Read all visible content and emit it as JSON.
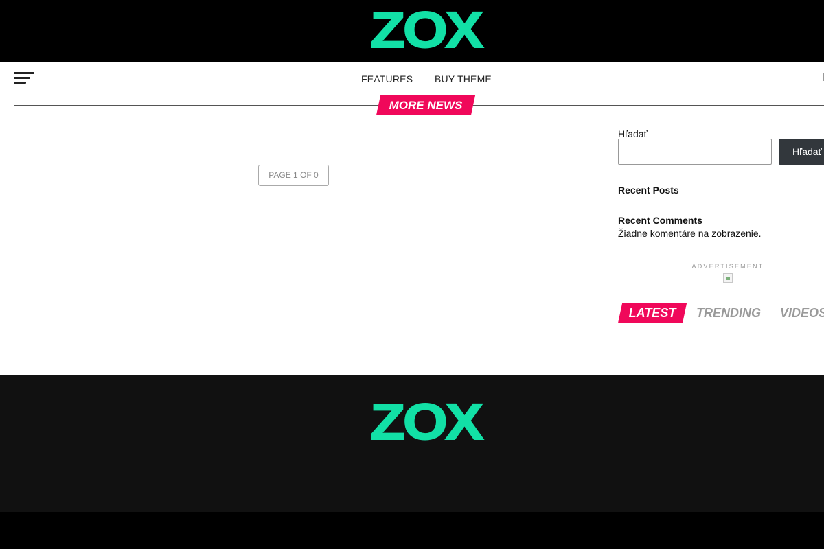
{
  "header": {
    "logo_text": "ZOX"
  },
  "nav": {
    "links": [
      {
        "label": "FEATURES"
      },
      {
        "label": "BUY THEME"
      }
    ]
  },
  "section": {
    "title": "MORE NEWS"
  },
  "pagination": {
    "label": "PAGE 1 OF 0"
  },
  "sidebar": {
    "search": {
      "label": "Hľadať",
      "value": "",
      "button_label": "Hľadať"
    },
    "recent_posts_title": "Recent Posts",
    "recent_comments_title": "Recent Comments",
    "no_comments_text": "Žiadne komentáre na zobrazenie.",
    "advertisement_label": "ADVERTISEMENT",
    "tabs": [
      {
        "label": "LATEST",
        "active": true
      },
      {
        "label": "TRENDING",
        "active": false
      },
      {
        "label": "VIDEOS",
        "active": false
      }
    ]
  },
  "footer": {
    "logo_text": "ZOX"
  },
  "colors": {
    "brand_green": "#12e0a6",
    "accent_pink": "#f0085a",
    "header_bg": "#000000",
    "footer_bg": "#111111"
  }
}
